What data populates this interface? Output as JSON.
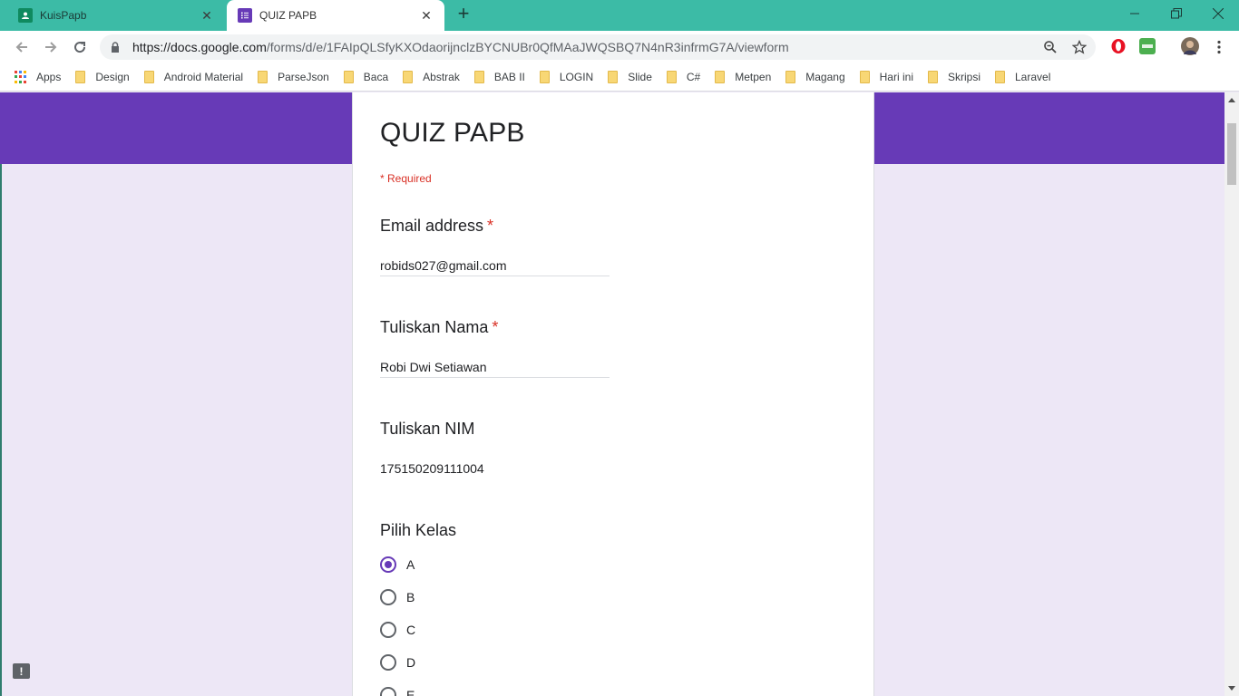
{
  "browser": {
    "tabs": [
      {
        "title": "KuisPapb",
        "icon": "classroom-icon",
        "active": false
      },
      {
        "title": "QUIZ PAPB",
        "icon": "google-forms-icon",
        "active": true
      }
    ],
    "address": {
      "host": "https://docs.google.com",
      "path": "/forms/d/e/1FAIpQLSfyKXOdaorijnclzBYCNUBr0QfMAaJWQSBQ7N4nR3infrmG7A/viewform"
    },
    "bookmarks": [
      "Apps",
      "Design",
      "Android Material",
      "ParseJson",
      "Baca",
      "Abstrak",
      "BAB II",
      "LOGIN",
      "Slide",
      "C#",
      "Metpen",
      "Magang",
      "Hari ini",
      "Skripsi",
      "Laravel"
    ],
    "colors": {
      "tabstrip": "#3cbba6",
      "accent": "#673ab7"
    }
  },
  "form": {
    "title": "QUIZ PAPB",
    "required_note": "* Required",
    "questions": [
      {
        "title": "Email address",
        "required": true,
        "star": "*",
        "answer": "robids027@gmail.com"
      },
      {
        "title": "Tuliskan Nama",
        "required": true,
        "star": "*",
        "answer": "Robi Dwi Setiawan"
      },
      {
        "title": "Tuliskan NIM",
        "required": false,
        "answer": "175150209111004"
      },
      {
        "title": "Pilih Kelas",
        "required": false,
        "options": [
          "A",
          "B",
          "C",
          "D",
          "E"
        ],
        "selected": "A"
      }
    ]
  }
}
